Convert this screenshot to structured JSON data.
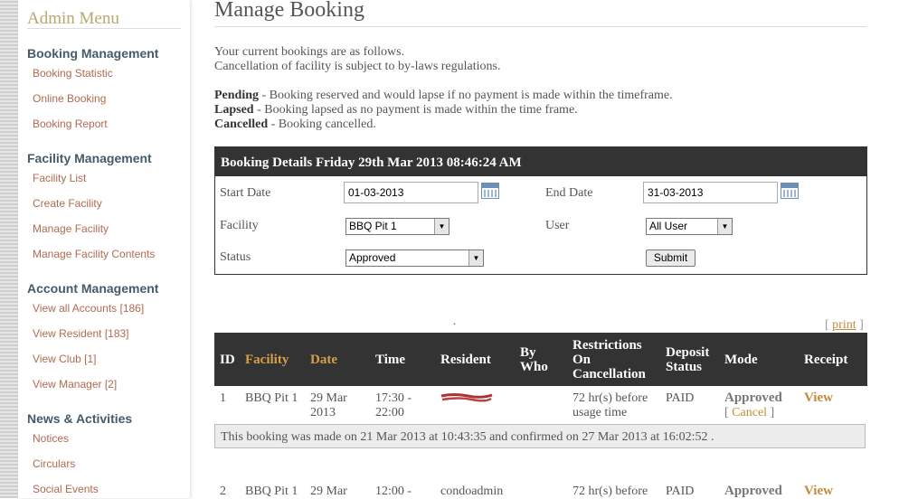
{
  "sidebar": {
    "title": "Admin Menu",
    "sections": [
      {
        "heading": "Booking Management",
        "items": [
          "Booking Statistic",
          "Online Booking",
          "Booking Report"
        ]
      },
      {
        "heading": "Facility Management",
        "items": [
          "Facility List",
          "Create Facility",
          "Manage Facility",
          "Manage Facility Contents"
        ]
      },
      {
        "heading": "Account Management",
        "items": [
          "View all Accounts [186]",
          "View Resident [183]",
          "View Club [1]",
          "View Manager [2]"
        ]
      },
      {
        "heading": "News & Activities",
        "items": [
          "Notices",
          "Circulars",
          "Social Events"
        ]
      }
    ]
  },
  "page": {
    "title": "Manage Booking",
    "intro_line1": "Your current bookings are as follows.",
    "intro_line2": "Cancellation of facility is subject to by-laws regulations.",
    "legend": [
      {
        "term": "Pending",
        "desc": " - Booking reserved and would lapse if no payment is made within the timeframe."
      },
      {
        "term": "Lapsed",
        "desc": " - Booking lapsed as no payment is made within the time frame."
      },
      {
        "term": "Cancelled",
        "desc": " - Booking cancelled."
      }
    ]
  },
  "filter": {
    "header": "Booking Details Friday 29th Mar 2013 08:46:24 AM",
    "start_date_label": "Start Date",
    "start_date_value": "01-03-2013",
    "end_date_label": "End Date",
    "end_date_value": "31-03-2013",
    "facility_label": "Facility",
    "facility_value": "BBQ Pit 1",
    "user_label": "User",
    "user_value": "All User",
    "status_label": "Status",
    "status_value": "Approved",
    "submit_label": "Submit"
  },
  "misc": {
    "dot": ".",
    "print_open": "[ ",
    "print_label": "print",
    "print_close": " ]"
  },
  "table": {
    "headers": {
      "id": "ID",
      "facility": "Facility",
      "date": "Date",
      "time": "Time",
      "resident": "Resident",
      "by_who_1": "By",
      "by_who_2": "Who",
      "restrictions_1": "Restrictions",
      "restrictions_2": "On",
      "restrictions_3": "Cancellation",
      "deposit_1": "Deposit",
      "deposit_2": "Status",
      "mode": "Mode",
      "receipt": "Receipt"
    },
    "rows": [
      {
        "id": "1",
        "facility": "BBQ Pit 1",
        "date_1": "29 Mar",
        "date_2": "2013",
        "time_1": "17:30 -",
        "time_2": "22:00",
        "resident": "",
        "restriction_1": "72 hr(s) before",
        "restriction_2": "usage time",
        "deposit": "PAID",
        "mode": "Approved",
        "cancel_open": "[ ",
        "cancel_label": "Cancel",
        "cancel_close": " ]",
        "receipt": "View",
        "note": "This booking was made on 21 Mar 2013 at 10:43:35 and confirmed on 27 Mar 2013 at 16:02:52 ."
      },
      {
        "id": "2",
        "facility": "BBQ Pit 1",
        "date_1": "29 Mar",
        "time_1": "12:00 -",
        "resident": "condoadmin",
        "restriction_1": "72 hr(s) before",
        "deposit": "PAID",
        "mode": "Approved",
        "receipt": "View"
      }
    ]
  },
  "colors": {
    "accent_gold": "#c58a3a",
    "header_dark": "#333333",
    "sidebar_heading": "#455a6a",
    "sidebar_link": "#b06a50"
  }
}
